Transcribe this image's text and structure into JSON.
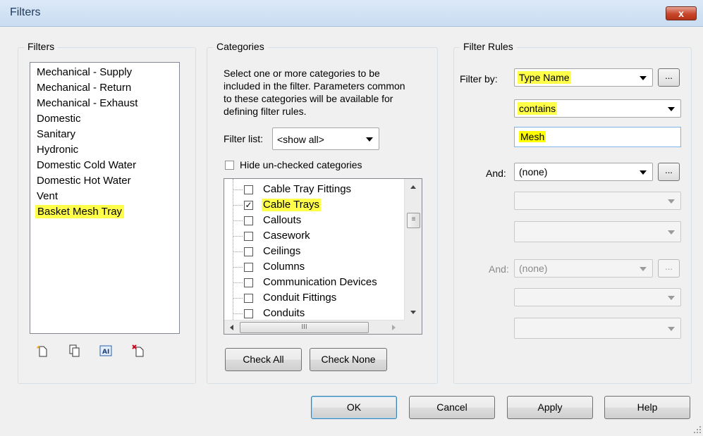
{
  "window": {
    "title": "Filters",
    "close_label": "x"
  },
  "filters_panel": {
    "label": "Filters",
    "items": [
      {
        "label": "Mechanical - Supply"
      },
      {
        "label": "Mechanical - Return"
      },
      {
        "label": "Mechanical - Exhaust"
      },
      {
        "label": "Domestic"
      },
      {
        "label": "Sanitary"
      },
      {
        "label": "Hydronic"
      },
      {
        "label": "Domestic Cold Water"
      },
      {
        "label": "Domestic Hot Water"
      },
      {
        "label": "Vent"
      },
      {
        "label": "Basket Mesh Tray",
        "selected": true
      }
    ],
    "toolbar_icons": [
      "new-filter-icon",
      "duplicate-filter-icon",
      "rename-filter-icon",
      "delete-filter-icon"
    ]
  },
  "categories_panel": {
    "label": "Categories",
    "description": "Select one or more categories to be included in the filter.  Parameters common to these categories will be available for defining filter rules.",
    "filter_list_label": "Filter list:",
    "filter_list_value": "<show all>",
    "hide_unchecked_label": "Hide un-checked categories",
    "hide_unchecked_checked": false,
    "categories": [
      {
        "label": "Cable Tray Fittings",
        "checked": false
      },
      {
        "label": "Cable Trays",
        "checked": true
      },
      {
        "label": "Callouts",
        "checked": false
      },
      {
        "label": "Casework",
        "checked": false
      },
      {
        "label": "Ceilings",
        "checked": false
      },
      {
        "label": "Columns",
        "checked": false
      },
      {
        "label": "Communication Devices",
        "checked": false
      },
      {
        "label": "Conduit Fittings",
        "checked": false
      },
      {
        "label": "Conduits",
        "checked": false
      }
    ],
    "check_all_label": "Check All",
    "check_none_label": "Check None"
  },
  "filter_rules_panel": {
    "label": "Filter Rules",
    "filter_by_label": "Filter by:",
    "filter_by_value": "Type Name",
    "operator_value": "contains",
    "rule_value": "Mesh",
    "and_label": "And:",
    "and_value": "(none)",
    "and2_label": "And:",
    "and2_value": "(none)",
    "ellipsis_label": "..."
  },
  "buttons": {
    "ok": "OK",
    "cancel": "Cancel",
    "apply": "Apply",
    "help": "Help"
  },
  "colors": {
    "highlight": "#ffff4a",
    "titlebar": "#c9dcf2",
    "close": "#c7452a"
  }
}
